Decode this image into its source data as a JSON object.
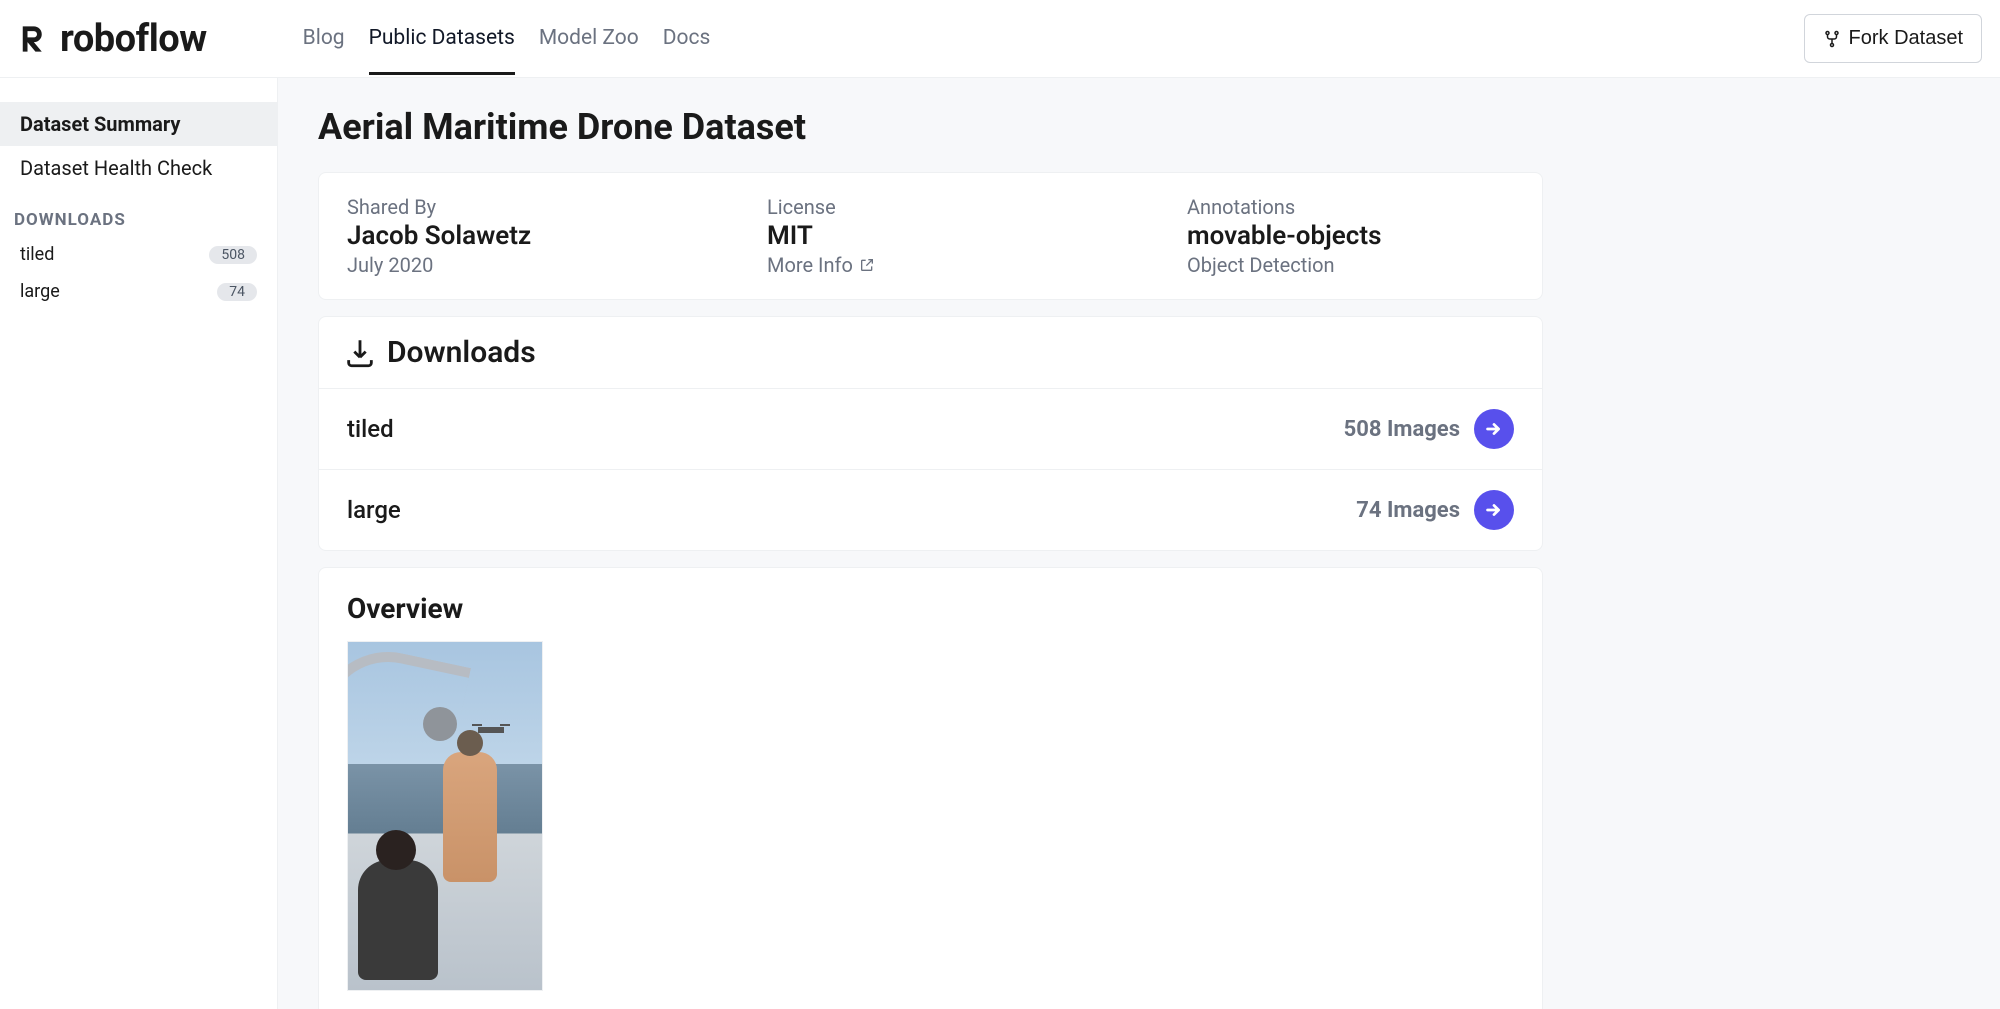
{
  "brand": "roboflow",
  "nav": {
    "items": [
      {
        "label": "Blog",
        "active": false
      },
      {
        "label": "Public Datasets",
        "active": true
      },
      {
        "label": "Model Zoo",
        "active": false
      },
      {
        "label": "Docs",
        "active": false
      }
    ]
  },
  "fork_button": "Fork Dataset",
  "sidebar": {
    "items": [
      {
        "label": "Dataset Summary",
        "active": true
      },
      {
        "label": "Dataset Health Check",
        "active": false
      }
    ],
    "downloads_heading": "DOWNLOADS",
    "downloads": [
      {
        "name": "tiled",
        "count": "508"
      },
      {
        "name": "large",
        "count": "74"
      }
    ]
  },
  "page_title": "Aerial Maritime Drone Dataset",
  "meta": {
    "shared_by_label": "Shared By",
    "shared_by_value": "Jacob Solawetz",
    "shared_by_sub": "July 2020",
    "license_label": "License",
    "license_value": "MIT",
    "license_sub": "More Info",
    "annotations_label": "Annotations",
    "annotations_value": "movable-objects",
    "annotations_sub": "Object Detection"
  },
  "downloads_section": {
    "title": "Downloads",
    "rows": [
      {
        "name": "tiled",
        "count": "508 Images"
      },
      {
        "name": "large",
        "count": "74 Images"
      }
    ]
  },
  "overview": {
    "title": "Overview"
  }
}
